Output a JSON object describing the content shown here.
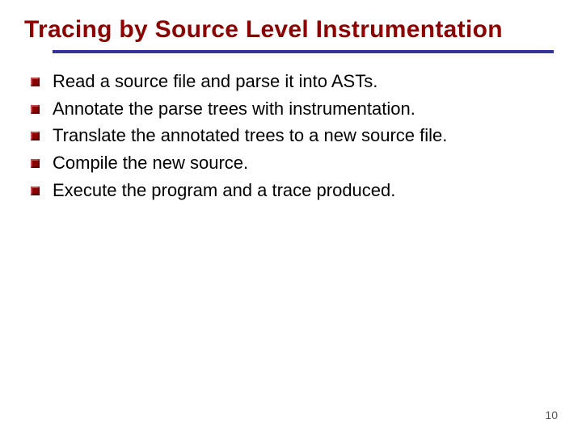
{
  "slide": {
    "title": "Tracing by Source Level Instrumentation",
    "bullets": [
      "Read a source file and parse it into ASTs.",
      "Annotate the parse trees with instrumentation.",
      "Translate the annotated trees to a new source file.",
      "Compile the new source.",
      "Execute the program and a trace produced."
    ],
    "page_number": "10"
  }
}
